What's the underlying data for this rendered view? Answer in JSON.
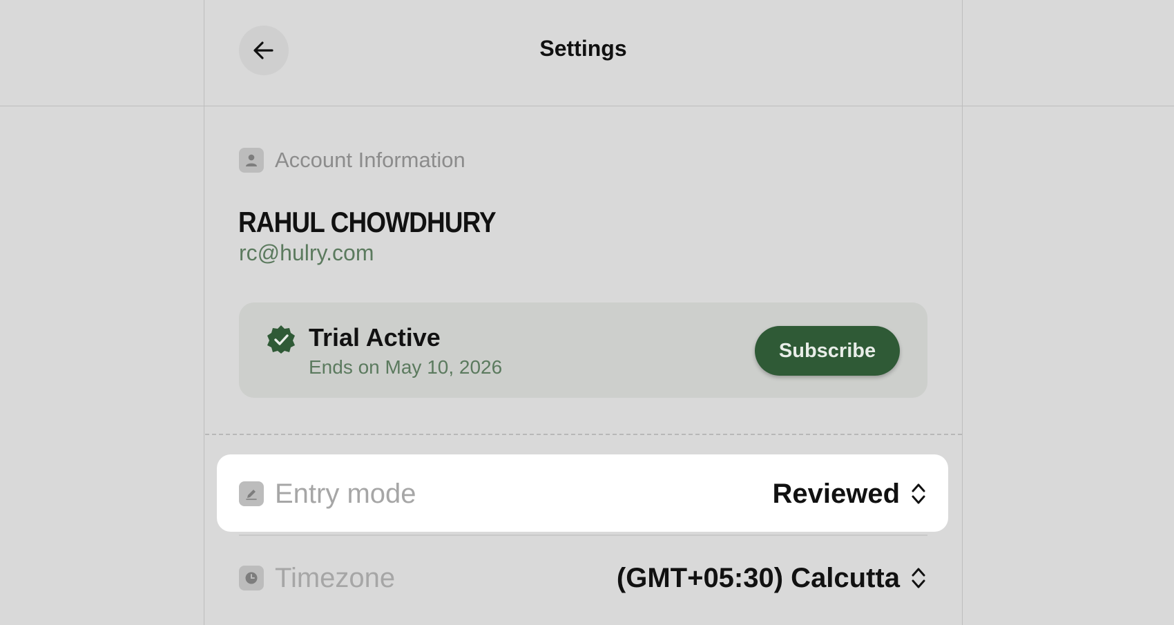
{
  "header": {
    "title": "Settings",
    "back_icon": "arrow-left-icon"
  },
  "account": {
    "section_label": "Account Information",
    "section_icon": "user-icon",
    "name": "RAHUL CHOWDHURY",
    "email": "rc@hulry.com"
  },
  "trial": {
    "icon": "verified-badge-icon",
    "title": "Trial Active",
    "subtitle": "Ends on May 10, 2026",
    "subscribe_label": "Subscribe"
  },
  "settings": {
    "entry_mode": {
      "icon": "pencil-icon",
      "label": "Entry mode",
      "value": "Reviewed"
    },
    "timezone": {
      "icon": "clock-icon",
      "label": "Timezone",
      "value": "(GMT+05:30) Calcutta"
    }
  },
  "colors": {
    "background": "#d9d9d9",
    "accent": "#2f5a36",
    "muted_green": "#5b7a5e",
    "card": "#cdcfcc"
  }
}
